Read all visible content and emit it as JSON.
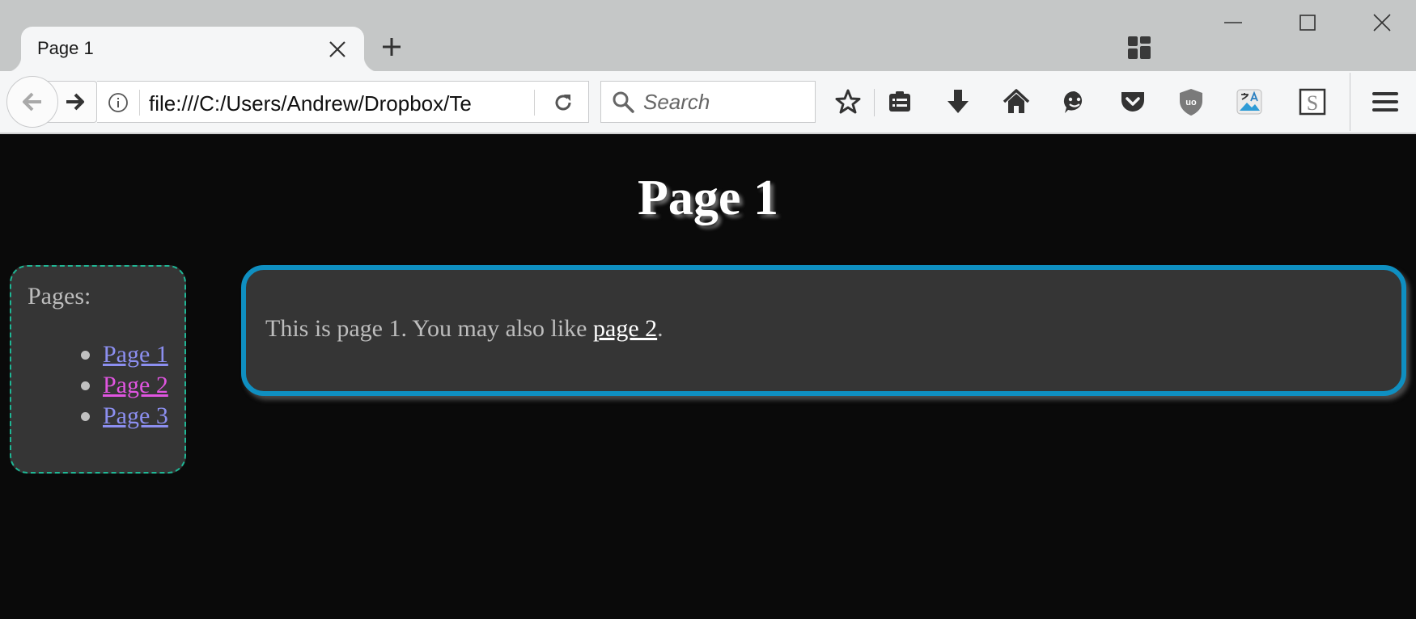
{
  "browser": {
    "tab": {
      "title": "Page 1"
    },
    "url": "file:///C:/Users/Andrew/Dropbox/Te",
    "search": {
      "placeholder": "Search"
    },
    "icons": {
      "tab_close": "close-icon",
      "new_tab": "plus-icon",
      "containers": "containers-icon",
      "minimize": "minimize-icon",
      "maximize": "maximize-icon",
      "window_close": "close-icon",
      "back": "back-arrow-icon",
      "forward": "forward-arrow-icon",
      "info": "info-icon",
      "reload": "reload-icon",
      "search": "search-icon",
      "bookmark": "star-icon",
      "library": "library-icon",
      "downloads": "download-icon",
      "home": "home-icon",
      "emoji": "emoji-icon",
      "pocket": "pocket-icon",
      "ublock": "ublock-icon",
      "translate": "translate-icon",
      "stylus": "stylus-icon",
      "menu": "hamburger-menu-icon"
    },
    "ublock_label": "uo",
    "stylus_label": "S"
  },
  "page": {
    "title": "Page 1",
    "sidebar": {
      "heading": "Pages:",
      "links": [
        {
          "label": "Page 1",
          "color": "#8c8ff0"
        },
        {
          "label": "Page 2",
          "color": "#e055e0"
        },
        {
          "label": "Page 3",
          "color": "#8c8ff0"
        }
      ]
    },
    "content": {
      "text_before": "This is page 1. You may also like ",
      "link_label": "page 2",
      "text_after": "."
    }
  },
  "colors": {
    "page_background": "#0a0a0a",
    "box_background": "#353535",
    "sidebar_border": "#1fb795",
    "content_border": "#0f8fc1"
  }
}
